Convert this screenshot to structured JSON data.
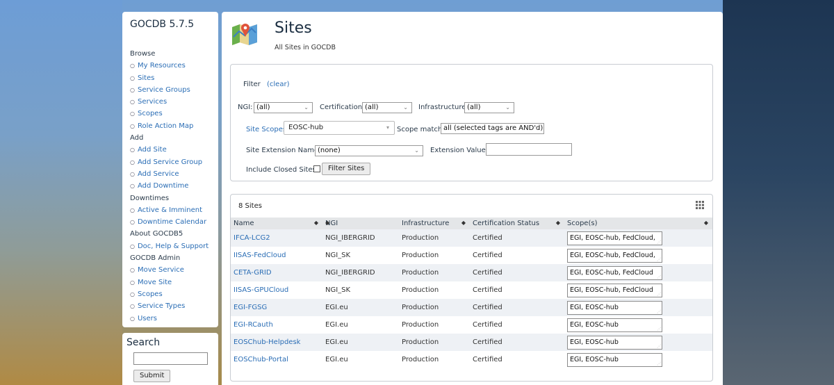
{
  "app": {
    "version_title": "GOCDB 5.7.5"
  },
  "sidebar": {
    "sections": [
      {
        "title": "Browse",
        "items": [
          "My Resources",
          "Sites",
          "Service Groups",
          "Services",
          "Scopes",
          "Role Action Map"
        ]
      },
      {
        "title": "Add",
        "items": [
          "Add Site",
          "Add Service Group",
          "Add Service",
          "Add Downtime"
        ]
      },
      {
        "title": "Downtimes",
        "items": [
          "Active & Imminent",
          "Downtime Calendar"
        ]
      },
      {
        "title": "About GOCDB5",
        "items": [
          "Doc, Help & Support"
        ]
      },
      {
        "title": "GOCDB Admin",
        "items": [
          "Move Service",
          "Move Site",
          "Scopes",
          "Service Types",
          "Users"
        ]
      }
    ]
  },
  "search": {
    "title": "Search",
    "input_value": "",
    "submit_label": "Submit"
  },
  "page": {
    "title": "Sites",
    "subtitle": "All Sites in GOCDB",
    "icon": "map-pin-icon"
  },
  "filter": {
    "heading": "Filter",
    "clear_label": "(clear)",
    "ngi_label": "NGI:",
    "ngi_value": "(all)",
    "certification_label": "Certification:",
    "certification_value": "(all)",
    "infrastructure_label": "Infrastructure:",
    "infrastructure_value": "(all)",
    "site_scopes_label": "Site Scopes:",
    "site_scopes_value": "EOSC-hub",
    "scope_match_label": "Scope match:",
    "scope_match_value": "all (selected tags are AND'd)",
    "extension_name_label": "Site Extension Name:",
    "extension_name_value": "(none)",
    "extension_value_label": "Extension Value:",
    "extension_value_value": "",
    "include_closed_label": "Include Closed Sites:",
    "include_closed_checked": false,
    "filter_button_label": "Filter Sites"
  },
  "results": {
    "count_label": "8 Sites",
    "columns": [
      "Name",
      "NGI",
      "Infrastructure",
      "Certification Status",
      "Scope(s)"
    ],
    "rows": [
      {
        "name": "IFCA-LCG2",
        "ngi": "NGI_IBERGRID",
        "infrastructure": "Production",
        "certification": "Certified",
        "scopes": "EGI, EOSC-hub, FedCloud,"
      },
      {
        "name": "IISAS-FedCloud",
        "ngi": "NGI_SK",
        "infrastructure": "Production",
        "certification": "Certified",
        "scopes": "EGI, EOSC-hub, FedCloud,"
      },
      {
        "name": "CETA-GRID",
        "ngi": "NGI_IBERGRID",
        "infrastructure": "Production",
        "certification": "Certified",
        "scopes": "EGI, EOSC-hub, FedCloud"
      },
      {
        "name": "IISAS-GPUCloud",
        "ngi": "NGI_SK",
        "infrastructure": "Production",
        "certification": "Certified",
        "scopes": "EGI, EOSC-hub, FedCloud"
      },
      {
        "name": "EGI-FGSG",
        "ngi": "EGI.eu",
        "infrastructure": "Production",
        "certification": "Certified",
        "scopes": "EGI, EOSC-hub"
      },
      {
        "name": "EGI-RCauth",
        "ngi": "EGI.eu",
        "infrastructure": "Production",
        "certification": "Certified",
        "scopes": "EGI, EOSC-hub"
      },
      {
        "name": "EOSChub-Helpdesk",
        "ngi": "EGI.eu",
        "infrastructure": "Production",
        "certification": "Certified",
        "scopes": "EGI, EOSC-hub"
      },
      {
        "name": "EOSChub-Portal",
        "ngi": "EGI.eu",
        "infrastructure": "Production",
        "certification": "Certified",
        "scopes": "EGI, EOSC-hub"
      }
    ]
  },
  "colors": {
    "link": "#2a6db5",
    "header_row": "#e4e6e8",
    "stripe_row": "#eef1f5"
  }
}
